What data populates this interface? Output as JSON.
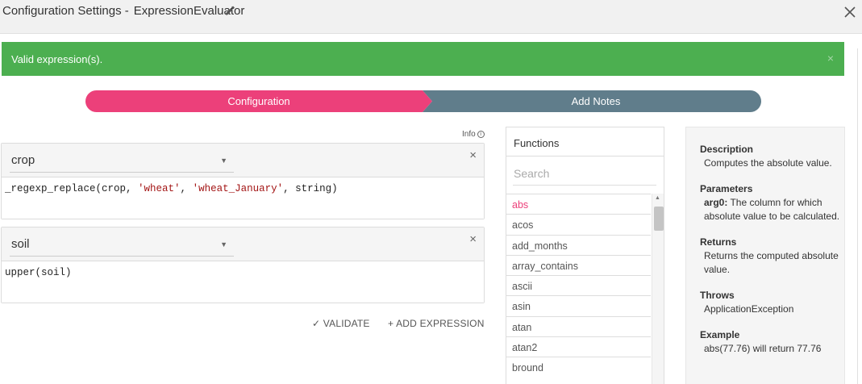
{
  "header": {
    "title_prefix": "Configuration Settings -",
    "title_name": "ExpressionEvaluator"
  },
  "alert": {
    "message": "Valid expression(s).",
    "dismiss": "×"
  },
  "steps": {
    "step1": "Configuration",
    "step2": "Add Notes"
  },
  "info_label": "Info",
  "expressions": [
    {
      "column": "crop",
      "remove": "×"
    },
    {
      "column": "soil",
      "remove": "×"
    }
  ],
  "code_parts": {
    "e0_a": "_regexp_replace(crop, ",
    "e0_s1": "'wheat'",
    "e0_b": ", ",
    "e0_s2": "'wheat_January'",
    "e0_c": ", string)",
    "e1": "upper(soil)"
  },
  "actions": {
    "validate": "VALIDATE",
    "add": "ADD EXPRESSION"
  },
  "functions": {
    "heading": "Functions",
    "search_placeholder": "Search",
    "items": [
      "abs",
      "acos",
      "add_months",
      "array_contains",
      "ascii",
      "asin",
      "atan",
      "atan2",
      "bround"
    ]
  },
  "description": {
    "desc_h": "Description",
    "desc_t": "Computes the absolute value.",
    "params_h": "Parameters",
    "arg_name": "arg0:",
    "arg_text": " The column for which absolute value to be calculated.",
    "returns_h": "Returns",
    "returns_t": "Returns the computed absolute value.",
    "throws_h": "Throws",
    "throws_t": "ApplicationException",
    "example_h": "Example",
    "example_t": "abs(77.76) will return 77.76"
  },
  "colors": {
    "success": "#4caf50",
    "primary": "#ec407a",
    "secondary": "#607d8b"
  },
  "icons": {
    "edit": "pencil-icon",
    "close": "close-icon",
    "info": "info-circle-icon",
    "validate": "check-icon",
    "add": "plus-icon"
  }
}
